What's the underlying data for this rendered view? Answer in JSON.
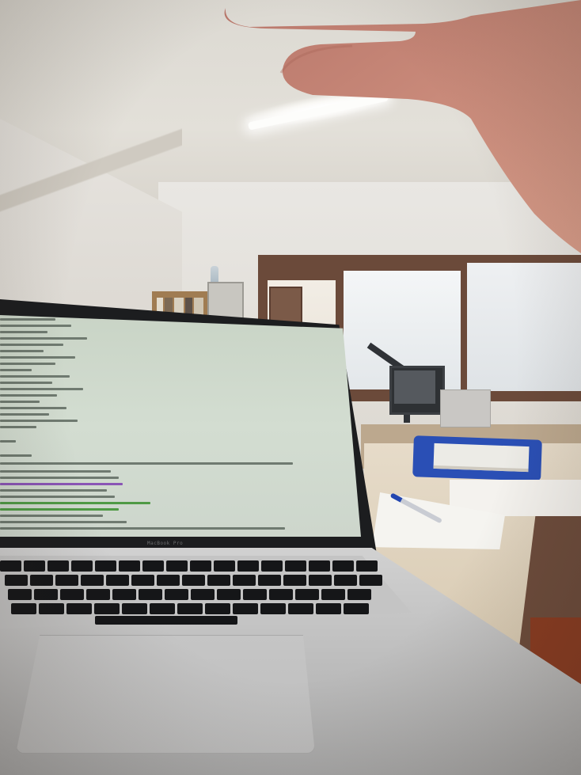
{
  "scene": {
    "laptop_brand_label": "MacBook Pro",
    "colors": {
      "laptop_lid": "#1c1d1f",
      "terminal_background": "#d3ddd1",
      "terminal_text": "#6f7a70",
      "terminal_highlight_green": "#4f9a45",
      "terminal_highlight_purple": "#8a55b5",
      "paper_tray": "#2a4fb5",
      "hand": "#c98a7a",
      "window_frame": "#6b4a3a"
    }
  }
}
